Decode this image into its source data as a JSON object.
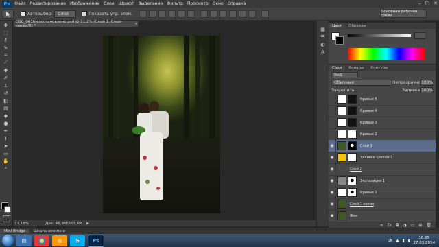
{
  "menu": {
    "logo": "Ps",
    "items": [
      "Файл",
      "Редактирование",
      "Изображение",
      "Слои",
      "Шрифт",
      "Выделение",
      "Фильтр",
      "Просмотр",
      "Окно",
      "Справка"
    ],
    "window_controls": [
      "–",
      "□",
      "✕"
    ]
  },
  "options": {
    "autoselect_label": "Автовыбор:",
    "autoselect_value": "Слой",
    "show_controls_label": "Показать упр. элем.",
    "workspace": "Основная рабочая среда"
  },
  "document": {
    "tab_title": "DSC_0016-восстановлено.psd @ 11,2% (Слой 1, Слой-маска/8) *",
    "close": "×",
    "zoom": "11,18%",
    "doc_size": "Док: 46,9M/263,6M"
  },
  "mini_bridge": {
    "tabs": [
      "Mini Bridge",
      "Шкала времени"
    ]
  },
  "color_panel": {
    "tabs": [
      "Цвет",
      "Образцы"
    ]
  },
  "layers_panel": {
    "tabs": [
      "Слои",
      "Каналы",
      "Контуры"
    ],
    "kind_filter": "Вид",
    "blend_mode": "Обычные",
    "opacity_label": "Непрозрачность:",
    "opacity_value": "100%",
    "lock_label": "Закрепить:",
    "fill_label": "Заливка:",
    "fill_value": "100%",
    "layers": [
      {
        "name": "Кривые 5",
        "visible": false
      },
      {
        "name": "Кривые 4",
        "visible": false
      },
      {
        "name": "Кривые 3",
        "visible": false
      },
      {
        "name": "Кривые 2",
        "visible": false
      },
      {
        "name": "Слой 1",
        "visible": true,
        "selected": true
      },
      {
        "name": "Заливка цветом 1",
        "visible": true
      },
      {
        "name": "Слой 2",
        "visible": true
      },
      {
        "name": "Экспозиция 1",
        "visible": true
      },
      {
        "name": "Кривые 1",
        "visible": true
      },
      {
        "name": "Слой 1 копия",
        "visible": true
      },
      {
        "name": "Фон",
        "visible": true
      }
    ]
  },
  "taskbar": {
    "lang": "UK",
    "time": "16:05",
    "date": "27.03.2014",
    "ps_label": "Ps"
  },
  "colors": {
    "accent_selection": "#5b6c8c",
    "fill_swatch": "#f5c400"
  }
}
